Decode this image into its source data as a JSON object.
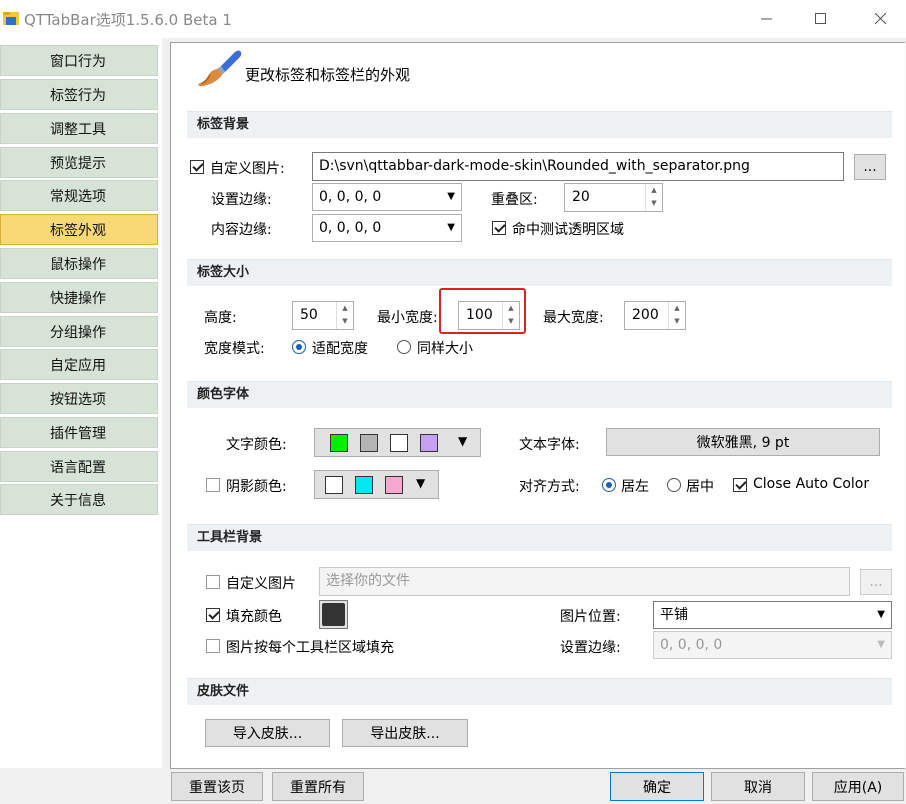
{
  "window": {
    "title": "QTTabBar选项1.5.6.0 Beta 1"
  },
  "sidebar": {
    "items": [
      {
        "label": "窗口行为"
      },
      {
        "label": "标签行为"
      },
      {
        "label": "调整工具"
      },
      {
        "label": "预览提示"
      },
      {
        "label": "常规选项"
      },
      {
        "label": "标签外观",
        "active": true
      },
      {
        "label": "鼠标操作"
      },
      {
        "label": "快捷操作"
      },
      {
        "label": "分组操作"
      },
      {
        "label": "自定应用"
      },
      {
        "label": "按钮选项"
      },
      {
        "label": "插件管理"
      },
      {
        "label": "语言配置"
      },
      {
        "label": "关于信息"
      }
    ]
  },
  "header": {
    "title": "更改标签和标签栏的外观",
    "icon": "paintbrush-icon"
  },
  "tab_bg": {
    "section": "标签背景",
    "custom_image_label": "自定义图片:",
    "custom_image_checked": true,
    "image_path": "D:\\svn\\qttabbar-dark-mode-skin\\Rounded_with_separator.png",
    "browse_label": "...",
    "margin_label": "设置边缘:",
    "margin_value": "0, 0, 0, 0",
    "overlap_label": "重叠区:",
    "overlap_value": "20",
    "padding_label": "内容边缘:",
    "padding_value": "0, 0, 0, 0",
    "hittest_label": "命中测试透明区域",
    "hittest_checked": true
  },
  "tab_size": {
    "section": "标签大小",
    "height_label": "高度:",
    "height_value": "50",
    "min_label": "最小宽度:",
    "min_value": "100",
    "max_label": "最大宽度:",
    "max_value": "200",
    "mode_label": "宽度模式:",
    "mode_fit": "适配宽度",
    "mode_same": "同样大小",
    "mode_selected": "fit"
  },
  "color_font": {
    "section": "颜色字体",
    "text_color_label": "文字颜色:",
    "text_colors": [
      "#00ee00",
      "#b4b4b4",
      "#ffffff",
      "#c8a0f0"
    ],
    "font_label": "文本字体:",
    "font_value": "微软雅黑, 9 pt",
    "shadow_label": "阴影颜色:",
    "shadow_checked": false,
    "shadow_colors": [
      "#ffffff",
      "#00e8f0",
      "#f4a8d0"
    ],
    "align_label": "对齐方式:",
    "align_left": "居左",
    "align_center": "居中",
    "align_selected": "left",
    "close_auto_color": "Close Auto Color",
    "close_auto_checked": true
  },
  "toolbar_bg": {
    "section": "工具栏背景",
    "custom_image_label": "自定义图片",
    "custom_image_checked": false,
    "file_placeholder": "选择你的文件",
    "browse_label": "...",
    "fill_color_label": "填充颜色",
    "fill_color_checked": true,
    "fill_color": "#333333",
    "image_pos_label": "图片位置:",
    "image_pos_value": "平铺",
    "per_toolbar_label": "图片按每个工具栏区域填充",
    "per_toolbar_checked": false,
    "margin_label": "设置边缘:",
    "margin_value": "0, 0, 0, 0"
  },
  "skin": {
    "section": "皮肤文件",
    "import_label": "导入皮肤...",
    "export_label": "导出皮肤..."
  },
  "footer": {
    "reset_page": "重置该页",
    "reset_all": "重置所有",
    "ok": "确定",
    "cancel": "取消",
    "apply": "应用(A)"
  }
}
